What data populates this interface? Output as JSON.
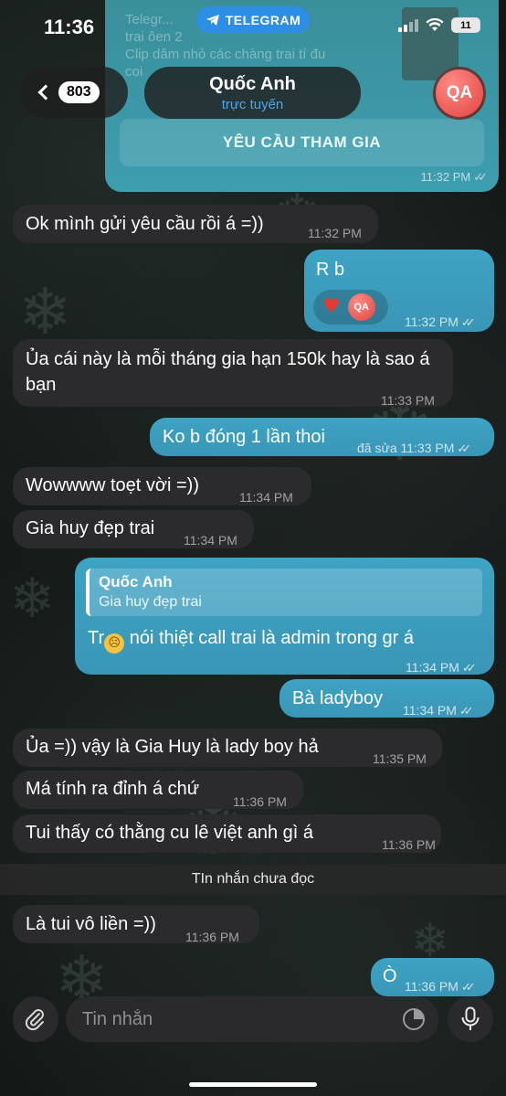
{
  "status_bar": {
    "time": "11:36",
    "app_pill": "TELEGRAM",
    "battery": "11"
  },
  "top_card": {
    "faint_text": "Telegr...\ntrai ôen 2\nClip dâm nhỏ các chàng trai tí đu\ncoi",
    "join_label": "YÊU CẦU THAM GIA",
    "time": "11:32 PM"
  },
  "header": {
    "back_count": "803",
    "name": "Quốc Anh",
    "status": "trực tuyến",
    "avatar_initials": "QA"
  },
  "messages": [
    {
      "text": "Ok mình gửi yêu cầu rồi á =))",
      "time": "11:32 PM"
    },
    {
      "text": "R b",
      "time": "11:32 PM",
      "reaction_initials": "QA"
    },
    {
      "text": "Ủa cái này là mỗi tháng gia hạn 150k hay là sao á bạn",
      "time": "11:33 PM"
    },
    {
      "text": "Ko b đóng 1 lần thoi",
      "time": "đã sửa 11:33 PM"
    },
    {
      "text": "Wowwww toẹt vời =))",
      "time": "11:34 PM"
    },
    {
      "text": "Gia huy đẹp trai",
      "time": "11:34 PM"
    },
    {
      "reply_name": "Quốc Anh",
      "reply_text": "Gia huy đẹp trai",
      "text_pre": "Tr",
      "text_post": " nói thiệt call trai là admin trong gr á",
      "time": "11:34 PM"
    },
    {
      "text": "Bà ladyboy",
      "time": "11:34 PM"
    },
    {
      "text": "Ủa =)) vậy là Gia Huy là lady boy hả",
      "time": "11:35 PM"
    },
    {
      "text": "Má tính ra đỉnh á chứ",
      "time": "11:36 PM"
    },
    {
      "text": "Tui thấy có thằng cu lê việt anh gì á",
      "time": "11:36 PM"
    },
    {
      "text": "Là tui vô liền =))",
      "time": "11:36 PM"
    },
    {
      "text": "Ò",
      "time": "11:36 PM"
    }
  ],
  "unread_label": "TIn nhắn chưa đọc",
  "input": {
    "placeholder": "Tin nhắn"
  },
  "colors": {
    "outgoing": "#3ea3c4",
    "incoming": "#2b2b2d",
    "accent": "#2d8ee6",
    "avatar": "#e0443f"
  },
  "icons": [
    "telegram-icon",
    "back-chevron-icon",
    "paperclip-icon",
    "sticker-icon",
    "microphone-icon",
    "heart-icon",
    "read-checks-icon"
  ]
}
